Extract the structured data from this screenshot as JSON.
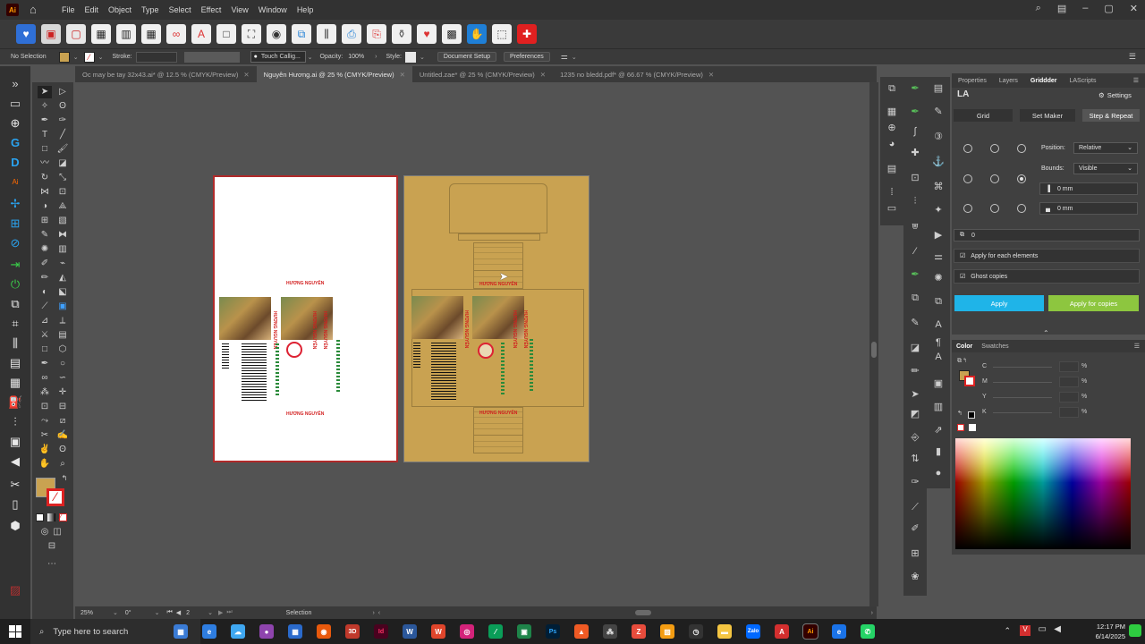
{
  "menubar": {
    "logo": "Ai",
    "items": [
      "File",
      "Edit",
      "Object",
      "Type",
      "Select",
      "Effect",
      "View",
      "Window",
      "Help"
    ]
  },
  "control_bar": {
    "selection_label": "No Selection",
    "stroke_label": "Stroke:",
    "brush_name": "Touch Callig...",
    "opacity_label": "Opacity:",
    "opacity_value": "100%",
    "style_label": "Style:",
    "document_setup": "Document Setup",
    "preferences": "Preferences"
  },
  "tabs": [
    {
      "label": "Oc may be tay 32x43.ai* @ 12.5 % (CMYK/Preview)",
      "active": false
    },
    {
      "label": "Nguyên Hương.ai @ 25 % (CMYK/Preview)",
      "active": true
    },
    {
      "label": "Untitled.zae* @ 25 % (CMYK/Preview)",
      "active": false
    },
    {
      "label": "1235 no bledd.pdf* @ 66.67 % (CMYK/Preview)",
      "active": false
    }
  ],
  "artwork": {
    "brand_text": "HƯƠNG NGUYÊN"
  },
  "status_bar": {
    "zoom": "25%",
    "rotation": "0°",
    "artboard_number": "2",
    "tool": "Selection"
  },
  "right_panel": {
    "tabs": [
      "Properties",
      "Layers",
      "Griddder",
      "LAScripts"
    ],
    "active_tab": "Griddder",
    "la_logo": "LA",
    "settings_label": "Settings",
    "segments": [
      "Grid",
      "Set Maker",
      "Step & Repeat"
    ],
    "position_label": "Position:",
    "position_value": "Relative",
    "bounds_label": "Bounds:",
    "bounds_value": "Visible",
    "gap_h": "0 mm",
    "gap_v": "0 mm",
    "count": "0",
    "apply_each": "Apply for each elements",
    "ghost_copies": "Ghost copies",
    "apply": "Apply",
    "apply_copies": "Apply for copies"
  },
  "color_panel": {
    "tabs": [
      "Color",
      "Swatches"
    ],
    "channels": [
      "C",
      "M",
      "Y",
      "K"
    ],
    "unit": "%"
  },
  "taskbar": {
    "search_placeholder": "Type here to search",
    "time": "12:17 PM",
    "date": "6/14/2025"
  },
  "colors": {
    "fill_swatch": "#c9a251",
    "apply_btn": "#1fb4e8",
    "apply_copies_btn": "#8dc63f"
  }
}
